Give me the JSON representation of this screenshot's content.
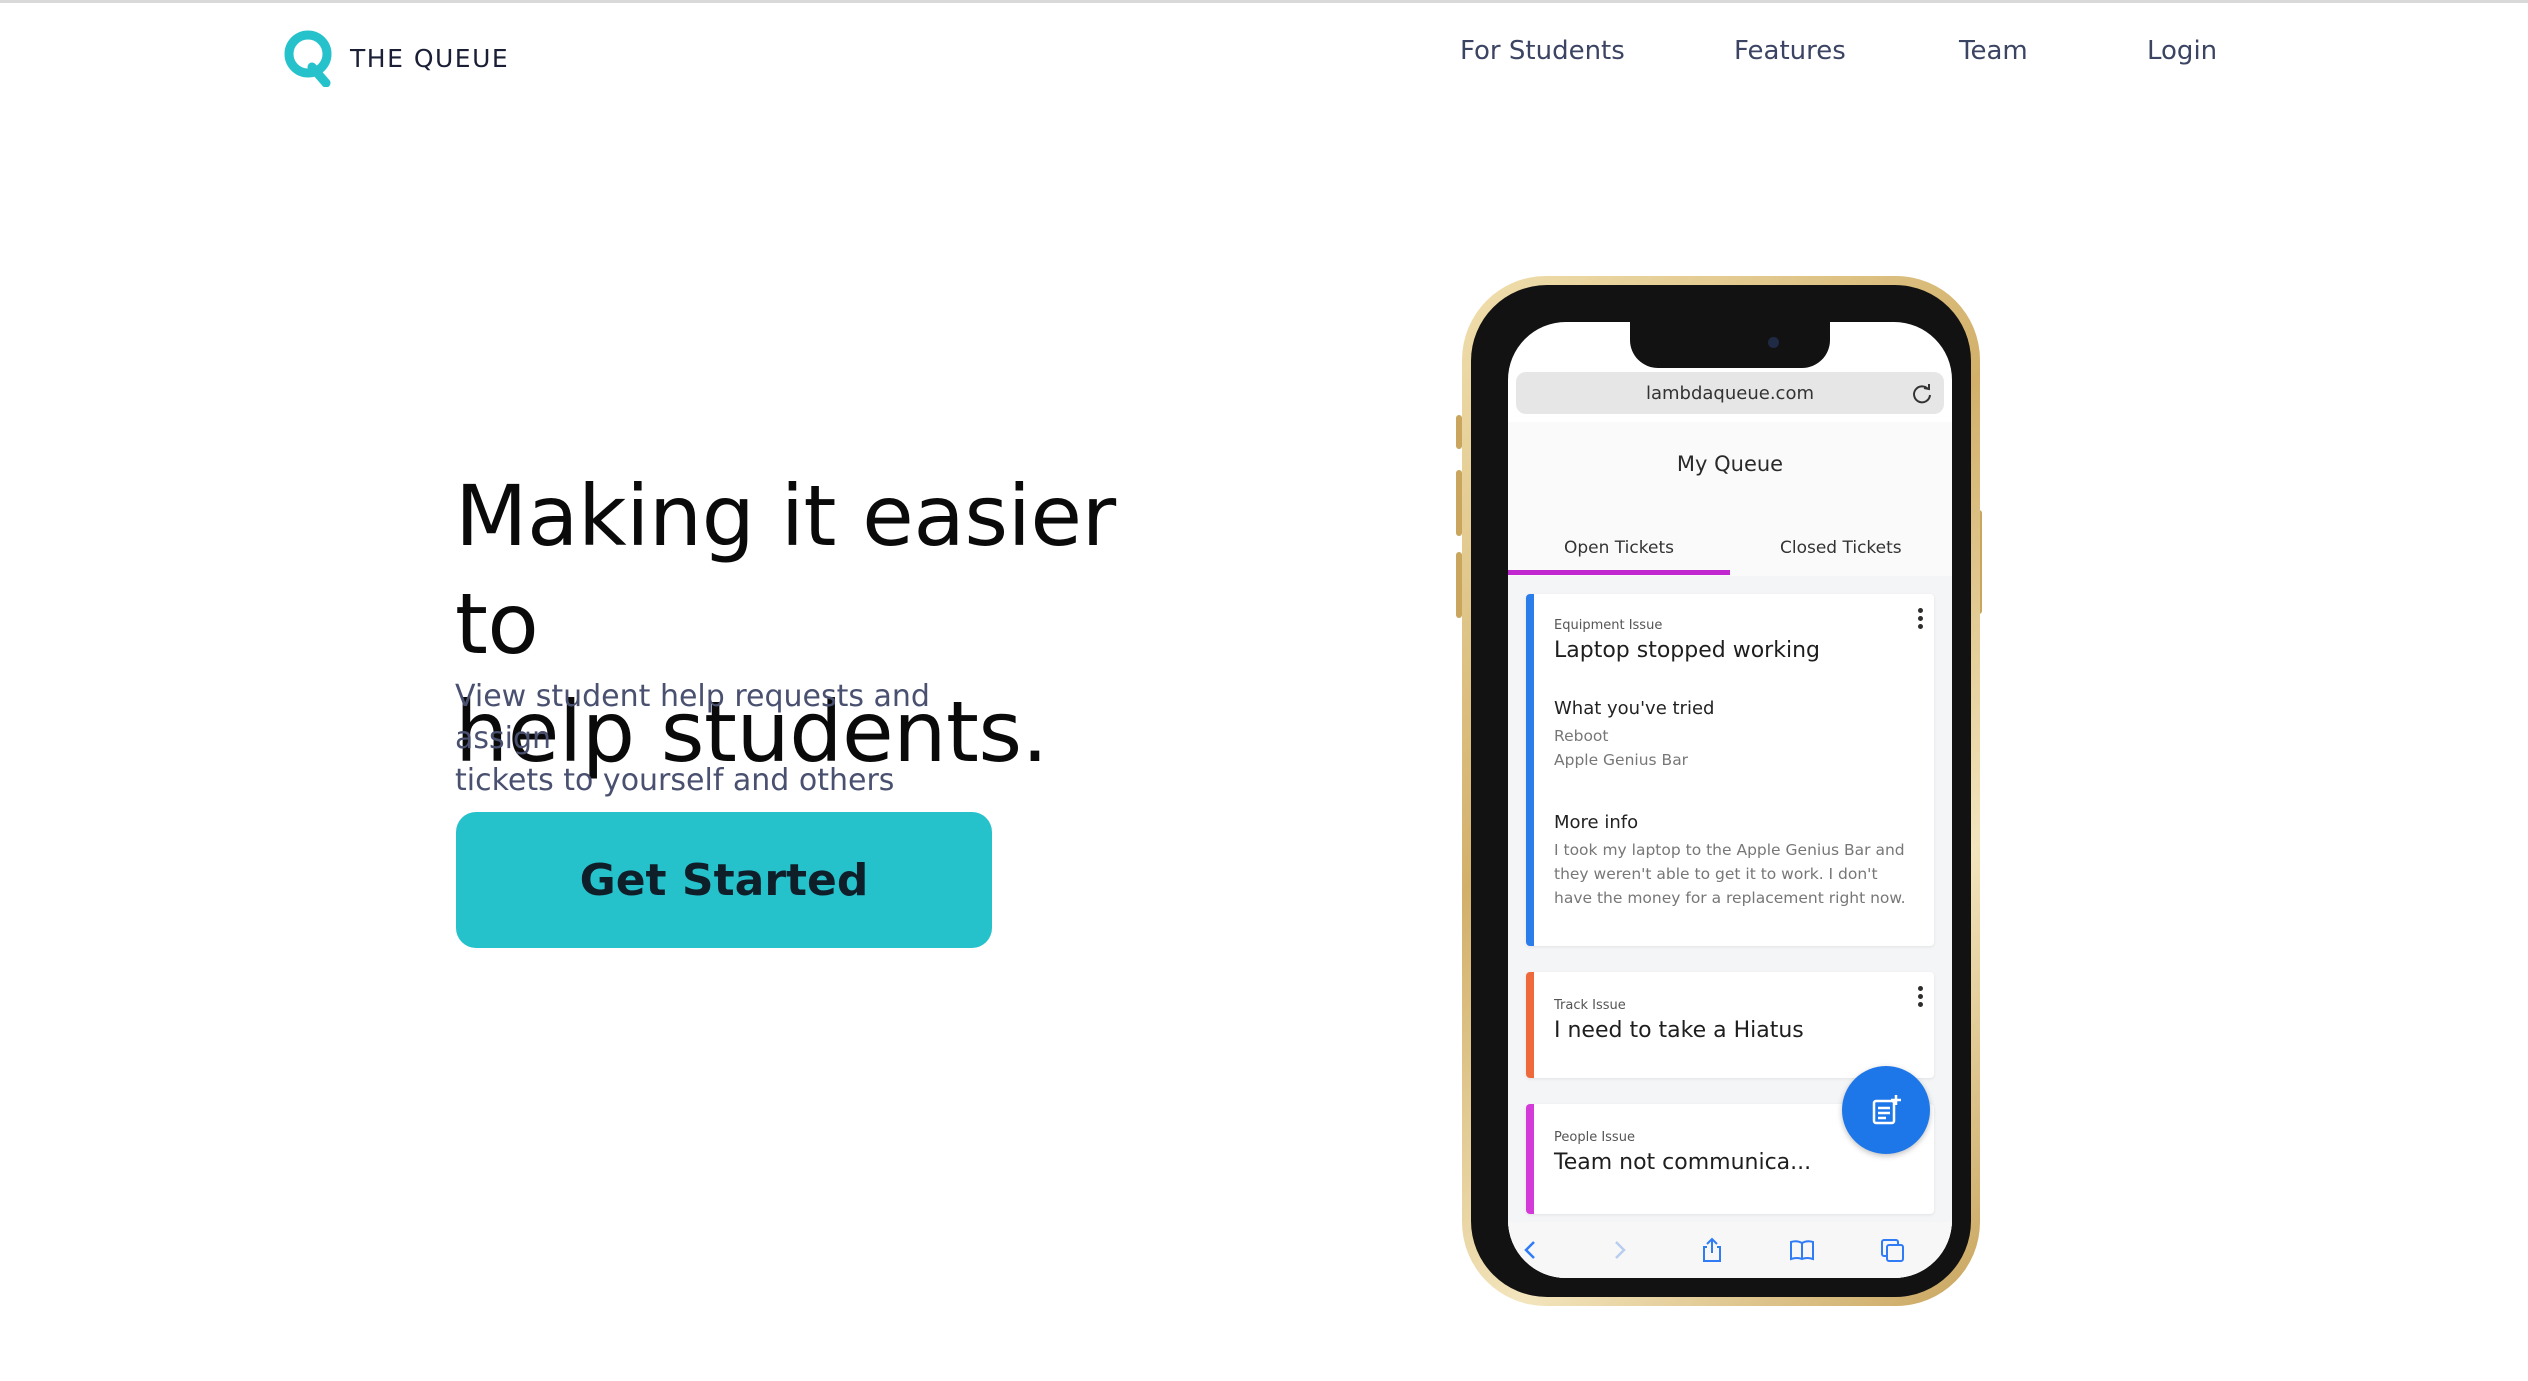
{
  "brand": {
    "name": "THE QUEUE",
    "logo_icon": "q-logo-icon",
    "accent_color": "#26c2cc"
  },
  "nav": {
    "items": [
      {
        "label": "For Students"
      },
      {
        "label": "Features"
      },
      {
        "label": "Team"
      },
      {
        "label": "Login"
      }
    ]
  },
  "hero": {
    "title_line1": "Making it easier to",
    "title_line2": "help students.",
    "subtitle_line1": "View student help requests and assign",
    "subtitle_line2": "tickets to yourself and others",
    "cta_label": "Get Started"
  },
  "phone": {
    "url": "lambdaqueue.com",
    "screen_title": "My Queue",
    "tabs": [
      {
        "label": "Open Tickets",
        "active": true
      },
      {
        "label": "Closed Tickets",
        "active": false
      }
    ],
    "tab_accent_color": "#c127cf",
    "tickets": [
      {
        "category": "Equipment Issue",
        "title": "Laptop stopped working",
        "tried_heading": "What you've tried",
        "tried": [
          "Reboot",
          "Apple Genius Bar"
        ],
        "info_heading": "More info",
        "info_lines": [
          "I took my laptop to the Apple Genius Bar and",
          "they weren't able to get it to work. I don't",
          "have the money for a replacement right now."
        ],
        "color": "#2b7de9"
      },
      {
        "category": "Track Issue",
        "title": "I need to take a Hiatus",
        "color": "#ee6a3c"
      },
      {
        "category": "People Issue",
        "title": "Team not communica...",
        "color": "#d33ad8"
      }
    ],
    "fab_icon": "new-ticket-icon",
    "bottom_icons": [
      "back-icon",
      "forward-icon",
      "share-icon",
      "bookmarks-icon",
      "tabs-icon"
    ]
  }
}
